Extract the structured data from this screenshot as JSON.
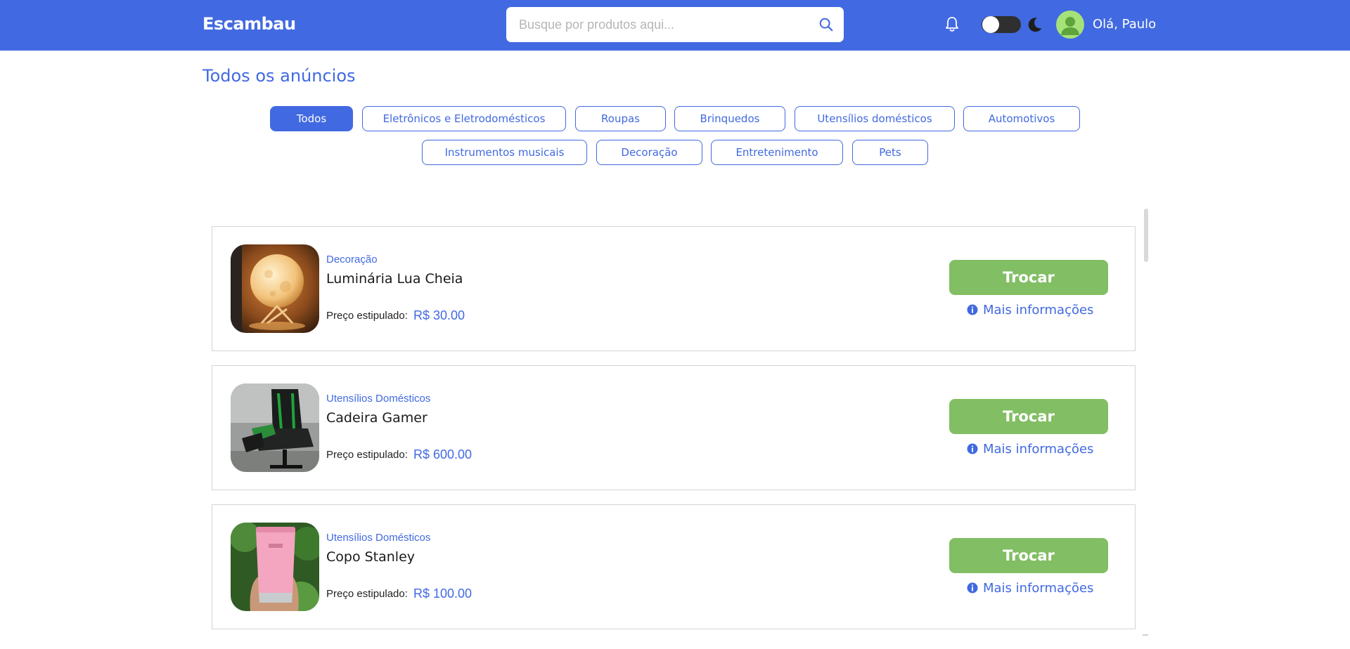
{
  "header": {
    "brand": "Escambau",
    "search": {
      "value": "",
      "placeholder": "Busque por produtos aqui..."
    },
    "dark_mode_enabled": false,
    "greeting": "Olá, Paulo",
    "background_color": "#4169e1",
    "icons": [
      "search-icon",
      "bell-icon",
      "moon-icon",
      "user-avatar-icon"
    ]
  },
  "main": {
    "title": "Todos os anúncios",
    "categories": [
      "Todos",
      "Eletrônicos e Eletrodomésticos",
      "Roupas",
      "Brinquedos",
      "Utensílios domésticos",
      "Automotivos",
      "Instrumentos musicais",
      "Decoração",
      "Entretenimento",
      "Pets"
    ],
    "selected_category": "Todos",
    "price_label": "Preço estipulado:",
    "trade_label": "Trocar",
    "more_info_label": "Mais informações",
    "listings": [
      {
        "category": "Decoração",
        "name": "Luminária Lua Cheia",
        "price": "R$ 30.00",
        "image": "moon-lamp-photo"
      },
      {
        "category": "Utensílios Domésticos",
        "name": "Cadeira Gamer",
        "price": "R$ 600.00",
        "image": "gamer-chair-photo"
      },
      {
        "category": "Utensílios Domésticos",
        "name": "Copo Stanley",
        "price": "R$ 100.00",
        "image": "pink-tumbler-photo"
      }
    ]
  },
  "colors": {
    "primary": "#4169e1",
    "trade_button": "#82be64",
    "avatar": "#a6e27a"
  }
}
